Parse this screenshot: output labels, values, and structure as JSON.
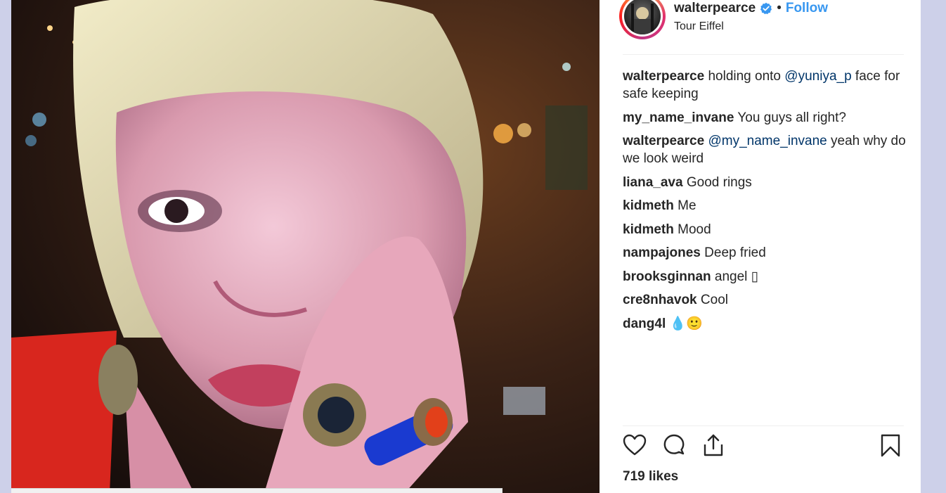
{
  "header": {
    "username": "walterpearce",
    "separator": "•",
    "follow_label": "Follow",
    "location": "Tour Eiffel"
  },
  "comments": [
    {
      "author": "walterpearce",
      "parts": [
        {
          "t": "holding onto ",
          "m": false
        },
        {
          "t": "@yuniya_p",
          "m": true
        },
        {
          "t": " face for safe keeping",
          "m": false
        }
      ]
    },
    {
      "author": "my_name_invane",
      "parts": [
        {
          "t": "You guys all right?",
          "m": false
        }
      ]
    },
    {
      "author": "walterpearce",
      "parts": [
        {
          "t": "@my_name_invane",
          "m": true
        },
        {
          "t": " yeah why do we look weird",
          "m": false
        }
      ]
    },
    {
      "author": "liana_ava",
      "parts": [
        {
          "t": "Good rings",
          "m": false
        }
      ]
    },
    {
      "author": "kidmeth",
      "parts": [
        {
          "t": "Me",
          "m": false
        }
      ]
    },
    {
      "author": "kidmeth",
      "parts": [
        {
          "t": "Mood",
          "m": false
        }
      ]
    },
    {
      "author": "nampajones",
      "parts": [
        {
          "t": "Deep fried",
          "m": false
        }
      ]
    },
    {
      "author": "brooksginnan",
      "parts": [
        {
          "t": "angel ▯",
          "m": false
        }
      ]
    },
    {
      "author": "cre8nhavok",
      "parts": [
        {
          "t": "Cool",
          "m": false
        }
      ]
    },
    {
      "author": "dang4l",
      "parts": [
        {
          "t": "💧🙂",
          "m": false,
          "e": true
        }
      ]
    }
  ],
  "likes_label": "719 likes",
  "icons": [
    "verified-icon",
    "heart-icon",
    "comment-icon",
    "share-icon",
    "bookmark-icon"
  ],
  "colors": {
    "follow": "#3897f0",
    "mention": "#003569",
    "text": "#262626",
    "background": "#cdd0e9"
  }
}
